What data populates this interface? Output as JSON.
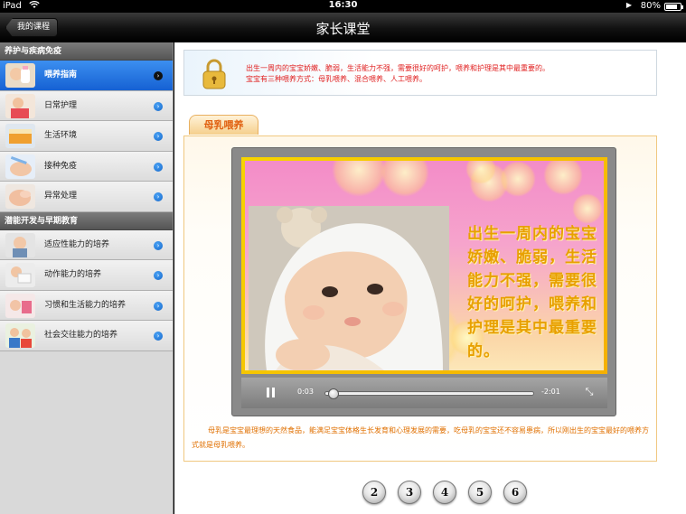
{
  "statusbar": {
    "carrier": "iPad",
    "time": "16:30",
    "battery_percent": "80%",
    "battery_level": 0.8,
    "icons": [
      "wifi-icon",
      "play-icon",
      "battery-icon"
    ]
  },
  "navbar": {
    "back_label": "我的课程",
    "title": "家长课堂"
  },
  "sidebar": {
    "sections": [
      {
        "title": "养护与疾病免疫",
        "items": [
          {
            "label": "喂养指南",
            "active": true
          },
          {
            "label": "日常护理",
            "active": false
          },
          {
            "label": "生活环境",
            "active": false
          },
          {
            "label": "接种免疫",
            "active": false
          },
          {
            "label": "异常处理",
            "active": false
          }
        ]
      },
      {
        "title": "潜能开发与早期教育",
        "items": [
          {
            "label": "适应性能力的培养",
            "active": false
          },
          {
            "label": "动作能力的培养",
            "active": false
          },
          {
            "label": "习惯和生活能力的培养",
            "active": false
          },
          {
            "label": "社会交往能力的培养",
            "active": false
          }
        ]
      }
    ]
  },
  "intro": {
    "line1": "出生一周内的宝宝娇嫩、脆弱，生活能力不强，需要很好的呵护，喂养和护理是其中最重要的。",
    "line2": "宝宝有三种喂养方式：母乳喂养、混合喂养、人工喂养。"
  },
  "tab": {
    "label": "母乳喂养"
  },
  "video": {
    "overlay_text": "出生一周内的宝宝娇嫩、脆弱，生活能力不强，需要很好的呵护，喂养和护理是其中最重要的。",
    "current_time": "0:03",
    "remaining_time": "-2:01",
    "progress": 0.02
  },
  "paragraph": "母乳是宝宝最理想的天然食品，能满足宝宝体格生长发育和心理发展的需要，吃母乳的宝宝还不容易患病，所以刚出生的宝宝最好的喂养方式就是母乳喂养。",
  "pager": {
    "pages": [
      "2",
      "3",
      "4",
      "5",
      "6"
    ]
  },
  "colors": {
    "accent_blue": "#1561d3",
    "intro_red": "#e02020",
    "paragraph_orange": "#e07000",
    "overlay_gold": "#e8a000"
  }
}
